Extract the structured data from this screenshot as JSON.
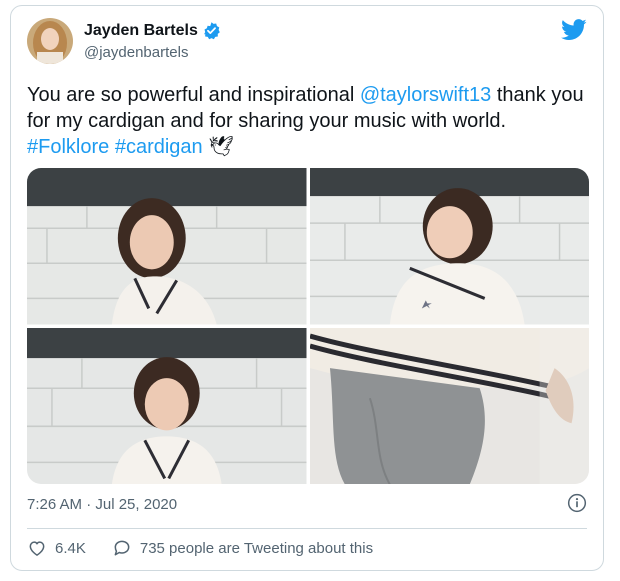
{
  "author": {
    "display_name": "Jayden Bartels",
    "handle": "@jaydenbartels",
    "verified": true
  },
  "tweet": {
    "text_plain_1": "You are so powerful and inspirational ",
    "mention": "@taylorswift13",
    "text_plain_2": " thank you for my cardigan and for sharing your music with world.",
    "hashtag_1": "#Folklore",
    "hashtag_2": "#cardigan",
    "emoji": "🕊"
  },
  "timestamp": "7:26 AM · Jul 25, 2020",
  "actions": {
    "likes": "6.4K",
    "conversation": "735 people are Tweeting about this"
  },
  "icons": {
    "brand": "twitter-bird-icon",
    "verified": "verified-badge-icon",
    "info": "info-icon",
    "like": "heart-icon",
    "reply": "speech-bubble-icon"
  },
  "colors": {
    "brand": "#1d9bf0",
    "text": "#0f1419",
    "muted": "#536471",
    "border": "#cfd9de"
  }
}
